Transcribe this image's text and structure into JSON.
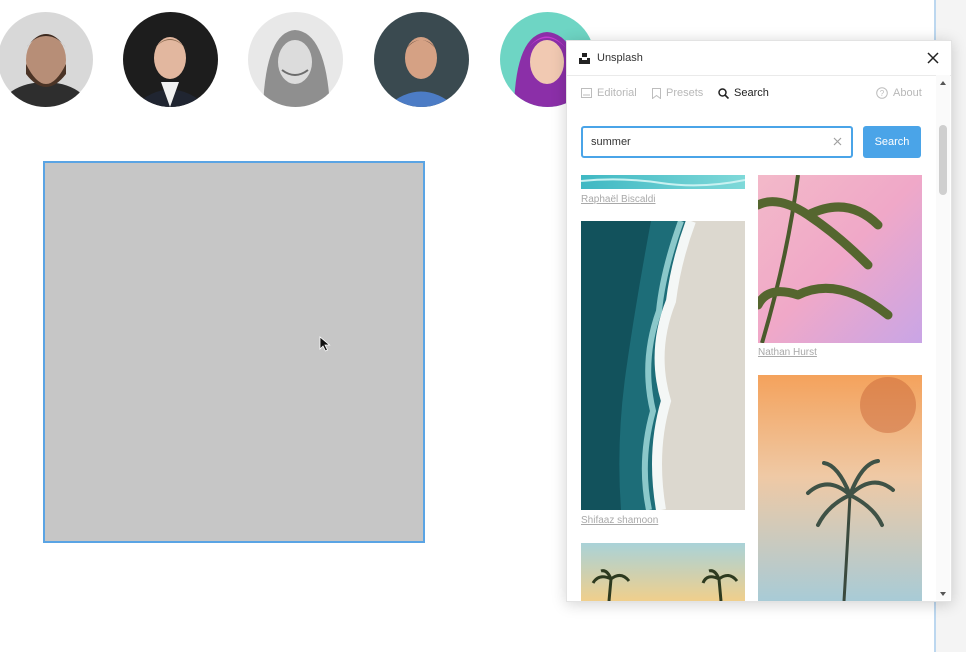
{
  "plugin": {
    "title": "Unsplash",
    "tabs": {
      "editorial": "Editorial",
      "presets": "Presets",
      "search": "Search",
      "about": "About"
    },
    "search_value": "summer",
    "search_button": "Search",
    "results": [
      {
        "credit": "Raphaël Biscaldi"
      },
      {
        "credit": "Nathan Hurst"
      },
      {
        "credit": "Shifaaz shamoon"
      }
    ]
  },
  "colors": {
    "accent": "#4aa4e8",
    "frame_fill": "#c6c6c6",
    "frame_border": "#5aa4e4"
  },
  "icons": [
    "unsplash-logo-icon",
    "close-icon",
    "editorial-icon",
    "bookmark-icon",
    "search-icon",
    "help-icon",
    "clear-icon",
    "cursor-icon"
  ]
}
